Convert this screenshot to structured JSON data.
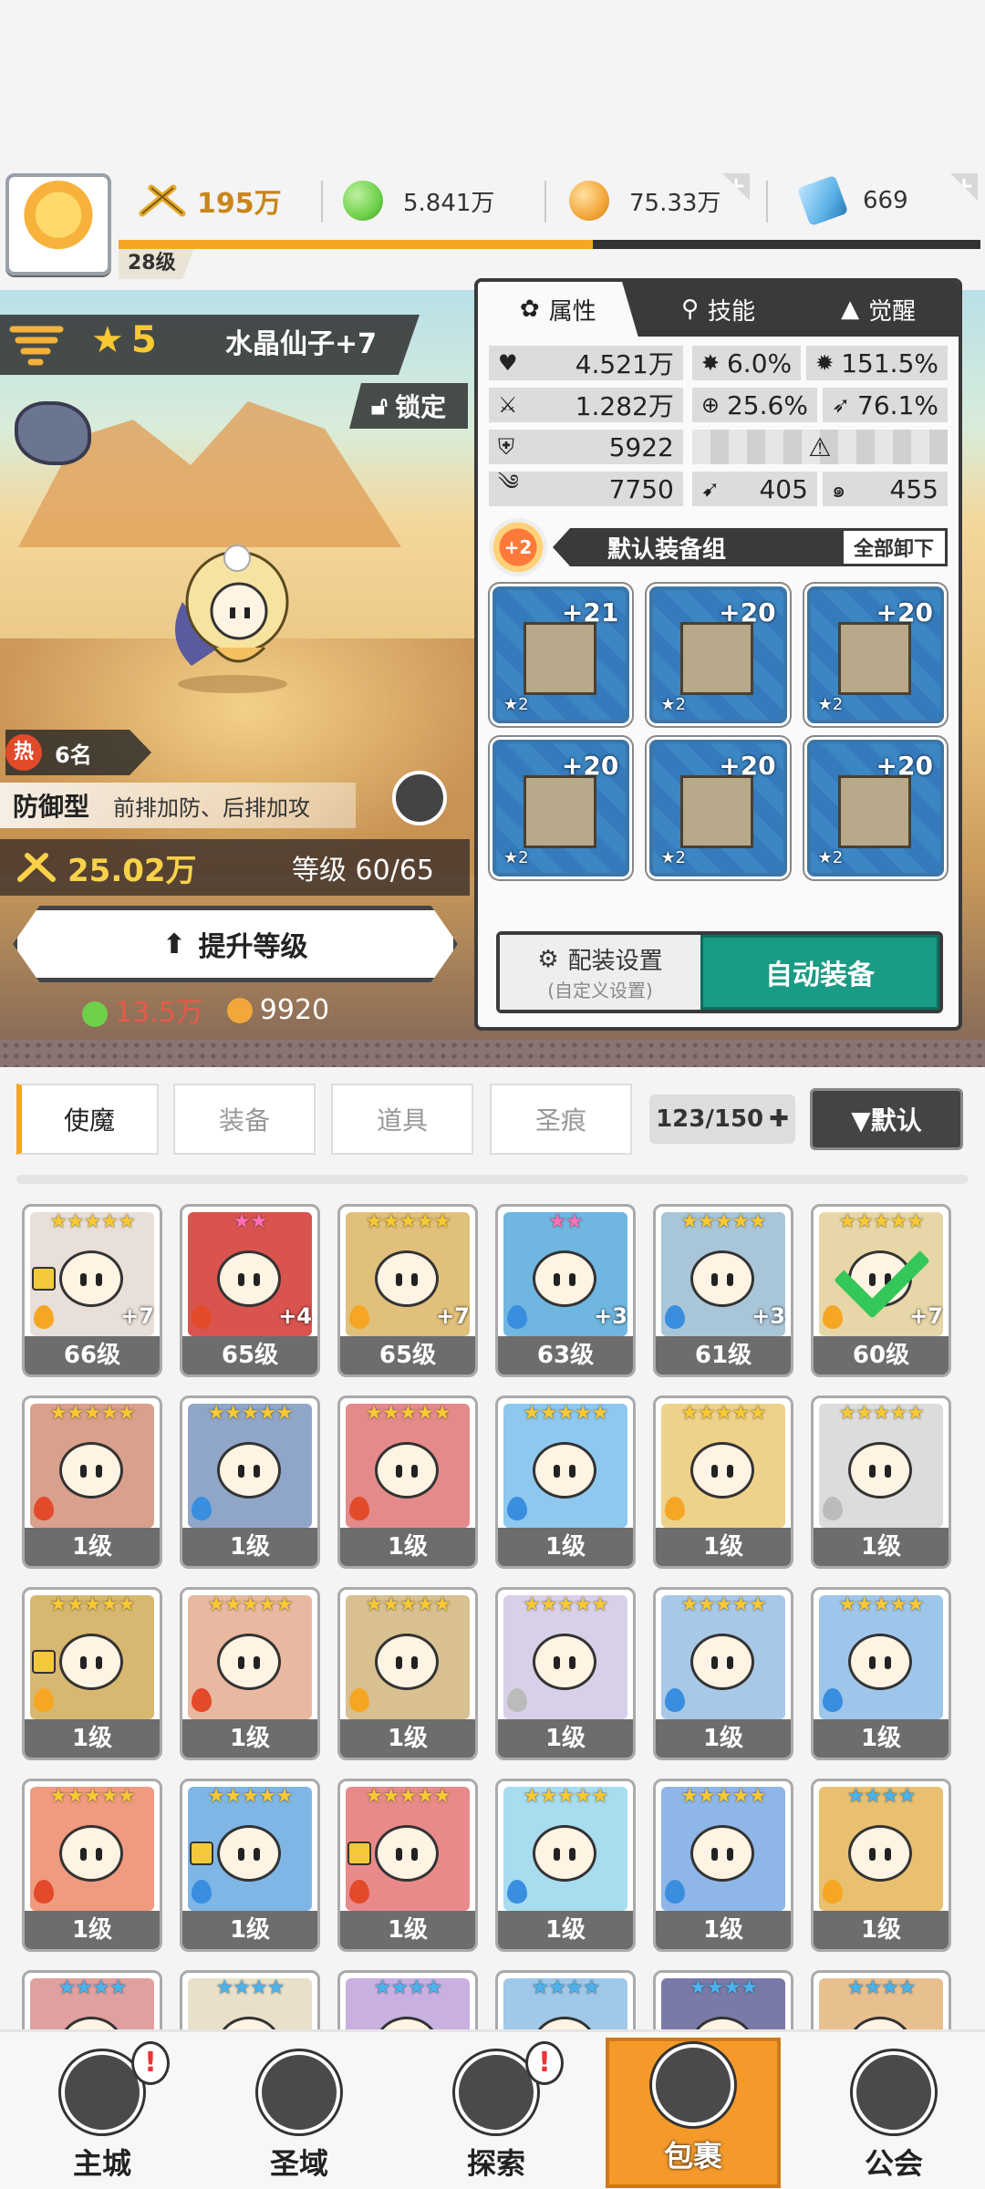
{
  "header": {
    "player_level": "28级",
    "power": "195万",
    "xp_fraction": 0.55,
    "resources": [
      {
        "name": "green-gem",
        "value": "5.841万",
        "color": "#6fd14a"
      },
      {
        "name": "gold-coin",
        "value": "75.33万",
        "color": "#f3a73a"
      },
      {
        "name": "blue-crystal",
        "value": "669",
        "color": "#5fb3e8"
      }
    ]
  },
  "hero": {
    "stars": "5",
    "name": "水晶仙子+7",
    "lock_label": "锁定",
    "hot_label": "热",
    "hot_rank": "6名",
    "role_type": "防御型",
    "role_desc": "前排加防、后排加攻",
    "power": "25.02万",
    "level": "等级 60/65",
    "upgrade_label": "提升等级",
    "cost_green": "13.5万",
    "cost_gold": "9920"
  },
  "panel": {
    "tabs": [
      "属性",
      "技能",
      "觉醒"
    ],
    "stats": {
      "hp": "4.521万",
      "crit": "6.0%",
      "crit_dmg": "151.5%",
      "atk": "1.282万",
      "hit": "25.6%",
      "dodge": "76.1%",
      "def": "5922",
      "speed": "7750",
      "pen": "405",
      "resist": "455"
    },
    "equip_plus": "+2",
    "equip_title": "默认装备组",
    "unequip_label": "全部卸下",
    "equipment": [
      {
        "name": "sword",
        "level": "+21",
        "stars": "★2"
      },
      {
        "name": "helmet",
        "level": "+20",
        "stars": "★2"
      },
      {
        "name": "armor",
        "level": "+20",
        "stars": "★2"
      },
      {
        "name": "belt",
        "level": "+20",
        "stars": "★2"
      },
      {
        "name": "necklace",
        "level": "+20",
        "stars": "★2"
      },
      {
        "name": "boots",
        "level": "+20",
        "stars": "★2"
      }
    ],
    "config_label": "配装设置",
    "config_sub": "(自定义设置)",
    "auto_equip_label": "自动装备"
  },
  "inventory": {
    "tabs": [
      "使魔",
      "装备",
      "道具",
      "圣痕"
    ],
    "count": "123/150",
    "sort_label": "▼默认",
    "cards": [
      {
        "stars": "★★★★★",
        "star_color": "gold",
        "level": "66级",
        "plus": "+7",
        "art": "#e8e0d8",
        "elem": "#f5a623",
        "lock": true
      },
      {
        "stars": "★★",
        "star_color": "pink",
        "level": "65级",
        "plus": "+4",
        "art": "#d9534f",
        "elem": "#e24a2a"
      },
      {
        "stars": "★★★★★",
        "star_color": "gold",
        "level": "65级",
        "plus": "+7",
        "art": "#e0c07a",
        "elem": "#f5a623"
      },
      {
        "stars": "★★",
        "star_color": "pink",
        "level": "63级",
        "plus": "+3",
        "art": "#6fb6e0",
        "elem": "#3a8ee0"
      },
      {
        "stars": "★★★★★",
        "star_color": "gold",
        "level": "61级",
        "plus": "+3",
        "art": "#a9c6d9",
        "elem": "#3a8ee0"
      },
      {
        "stars": "★★★★★",
        "star_color": "gold",
        "level": "60级",
        "plus": "+7",
        "art": "#e7d7a8",
        "elem": "#f5a623",
        "check": true
      },
      {
        "stars": "★★★★★",
        "star_color": "gold",
        "level": "1级",
        "plus": "",
        "art": "#d9a08c",
        "elem": "#e24a2a"
      },
      {
        "stars": "★★★★★",
        "star_color": "gold",
        "level": "1级",
        "plus": "",
        "art": "#8fa6c8",
        "elem": "#3a8ee0"
      },
      {
        "stars": "★★★★★",
        "star_color": "gold",
        "level": "1级",
        "plus": "",
        "art": "#e58a8a",
        "elem": "#e24a2a"
      },
      {
        "stars": "★★★★★",
        "star_color": "gold",
        "level": "1级",
        "plus": "",
        "art": "#8ec8ef",
        "elem": "#3a8ee0"
      },
      {
        "stars": "★★★★★",
        "star_color": "gold",
        "level": "1级",
        "plus": "",
        "art": "#efd28a",
        "elem": "#f5a623"
      },
      {
        "stars": "★★★★★",
        "star_color": "gold",
        "level": "1级",
        "plus": "",
        "art": "#dcdcdc",
        "elem": "#bbbbbb"
      },
      {
        "stars": "★★★★★",
        "star_color": "gold",
        "level": "1级",
        "plus": "",
        "art": "#d8b870",
        "elem": "#f5a623",
        "lock": true
      },
      {
        "stars": "★★★★★",
        "star_color": "gold",
        "level": "1级",
        "plus": "",
        "art": "#e9b8a0",
        "elem": "#e24a2a"
      },
      {
        "stars": "★★★★★",
        "star_color": "gold",
        "level": "1级",
        "plus": "",
        "art": "#d8c090",
        "elem": "#f5a623"
      },
      {
        "stars": "★★★★★",
        "star_color": "gold",
        "level": "1级",
        "plus": "",
        "art": "#d8d0e8",
        "elem": "#bbbbbb"
      },
      {
        "stars": "★★★★★",
        "star_color": "gold",
        "level": "1级",
        "plus": "",
        "art": "#a8c8e8",
        "elem": "#3a8ee0"
      },
      {
        "stars": "★★★★★",
        "star_color": "gold",
        "level": "1级",
        "plus": "",
        "art": "#9ec6ea",
        "elem": "#3a8ee0"
      },
      {
        "stars": "★★★★★",
        "star_color": "gold",
        "level": "1级",
        "plus": "",
        "art": "#f09a80",
        "elem": "#e24a2a"
      },
      {
        "stars": "★★★★★",
        "star_color": "gold",
        "level": "1级",
        "plus": "",
        "art": "#7fb6e6",
        "elem": "#3a8ee0",
        "lock": true
      },
      {
        "stars": "★★★★★",
        "star_color": "gold",
        "level": "1级",
        "plus": "",
        "art": "#e98a8a",
        "elem": "#e24a2a",
        "lock": true
      },
      {
        "stars": "★★★★★",
        "star_color": "gold",
        "level": "1级",
        "plus": "",
        "art": "#a8dcef",
        "elem": "#3a8ee0"
      },
      {
        "stars": "★★★★★",
        "star_color": "gold",
        "level": "1级",
        "plus": "",
        "art": "#8fb6e8",
        "elem": "#3a8ee0"
      },
      {
        "stars": "★★★★",
        "star_color": "blue",
        "level": "1级",
        "plus": "",
        "art": "#e8c070",
        "elem": "#f5a623"
      },
      {
        "stars": "★★★★",
        "star_color": "blue",
        "level": "",
        "plus": "",
        "art": "#e0a0a0",
        "elem": ""
      },
      {
        "stars": "★★★★",
        "star_color": "blue",
        "level": "",
        "plus": "",
        "art": "#e8e0c8",
        "elem": ""
      },
      {
        "stars": "★★★★",
        "star_color": "blue",
        "level": "",
        "plus": "",
        "art": "#c8b0e0",
        "elem": ""
      },
      {
        "stars": "★★★★",
        "star_color": "blue",
        "level": "",
        "plus": "",
        "art": "#a0c8e8",
        "elem": ""
      },
      {
        "stars": "★★★★",
        "star_color": "blue",
        "level": "",
        "plus": "",
        "art": "#7a7aa8",
        "elem": ""
      },
      {
        "stars": "★★★★",
        "star_color": "blue",
        "level": "",
        "plus": "",
        "art": "#e8c090",
        "elem": ""
      }
    ]
  },
  "nav": [
    {
      "label": "主城",
      "badge": "!"
    },
    {
      "label": "圣域",
      "badge": ""
    },
    {
      "label": "探索",
      "badge": "!"
    },
    {
      "label": "包裹",
      "badge": "",
      "active": true
    },
    {
      "label": "公会",
      "badge": ""
    }
  ]
}
